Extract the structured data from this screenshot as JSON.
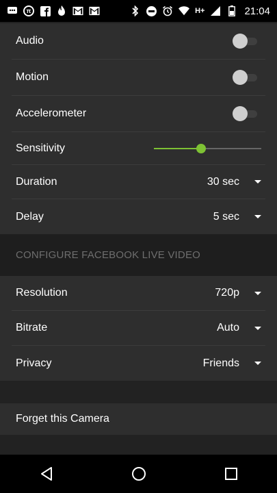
{
  "status_bar": {
    "time": "21:04",
    "network": "H+",
    "icons": [
      "messages-icon",
      "pi-icon",
      "facebook-icon",
      "flame-icon",
      "gmail-icon",
      "gmail-icon",
      "bluetooth-icon",
      "do-not-disturb-icon",
      "alarm-icon",
      "wifi-icon",
      "signal-icon",
      "battery-icon"
    ]
  },
  "settings": {
    "audio_label": "Audio",
    "motion_label": "Motion",
    "accelerometer_label": "Accelerometer",
    "sensitivity_label": "Sensitivity",
    "sensitivity_value": 0.44,
    "duration_label": "Duration",
    "duration_value": "30 sec",
    "delay_label": "Delay",
    "delay_value": "5 sec"
  },
  "facebook_section": {
    "header": "CONFIGURE FACEBOOK LIVE VIDEO",
    "resolution_label": "Resolution",
    "resolution_value": "720p",
    "bitrate_label": "Bitrate",
    "bitrate_value": "Auto",
    "privacy_label": "Privacy",
    "privacy_value": "Friends"
  },
  "forget_camera_label": "Forget this Camera",
  "colors": {
    "accent": "#7ec234",
    "background": "#222222",
    "row": "#2e2e2e",
    "header_text": "#6e6e6e"
  },
  "nav_bar": {
    "back": "back-icon",
    "home": "home-icon",
    "recents": "recents-icon"
  }
}
